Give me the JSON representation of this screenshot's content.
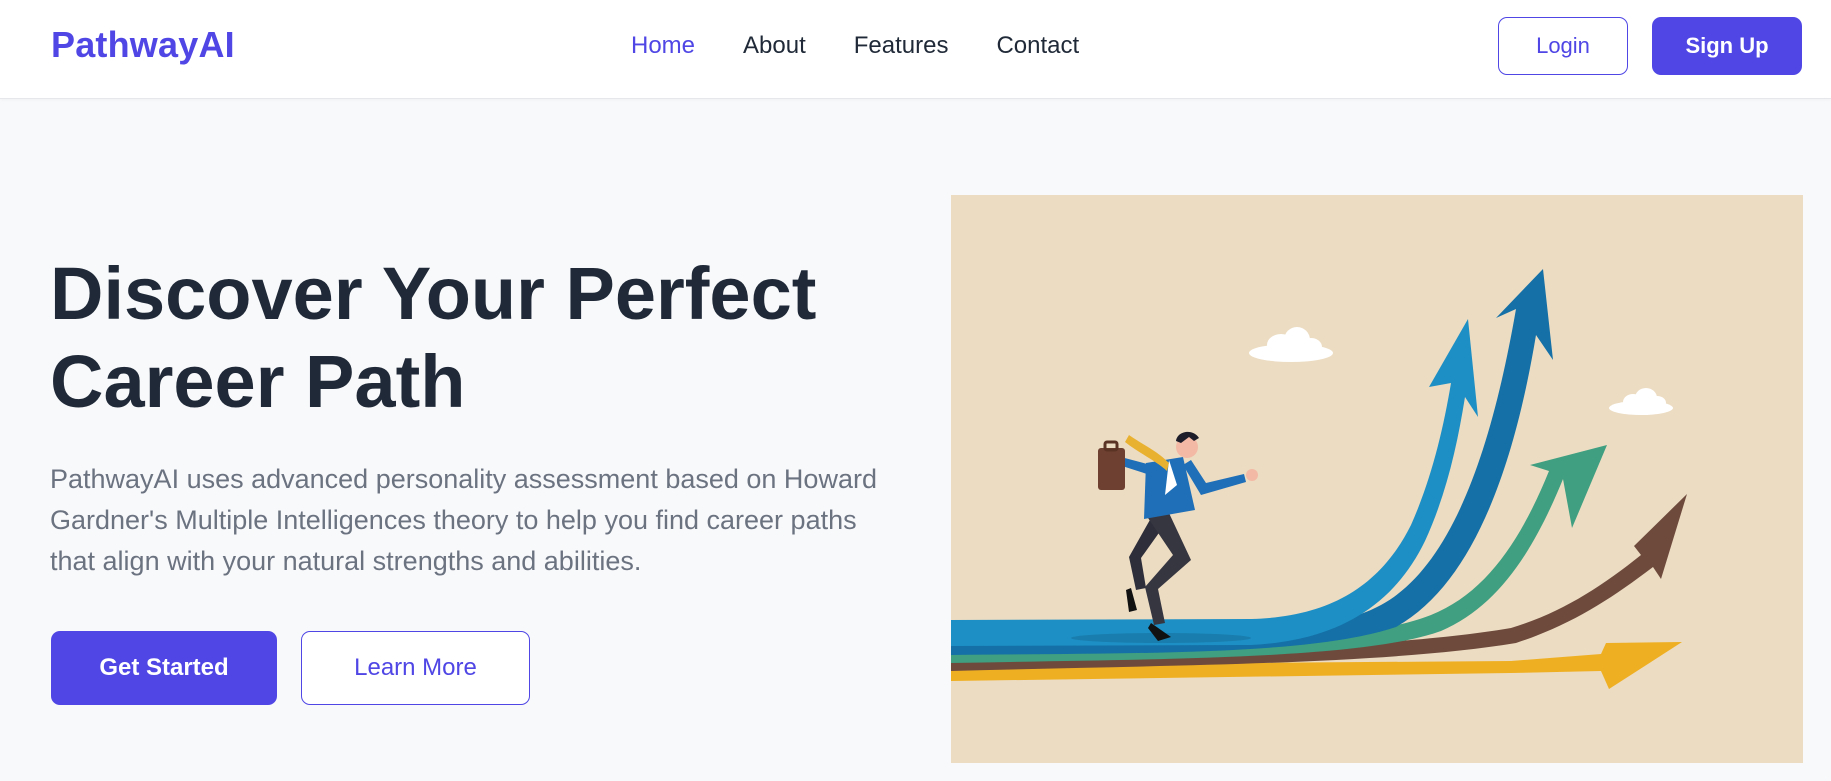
{
  "brand": {
    "name": "PathwayAI",
    "accent": "#4f46e5"
  },
  "nav": {
    "links": [
      {
        "label": "Home",
        "active": true
      },
      {
        "label": "About",
        "active": false
      },
      {
        "label": "Features",
        "active": false
      },
      {
        "label": "Contact",
        "active": false
      }
    ],
    "login_label": "Login",
    "signup_label": "Sign Up"
  },
  "hero": {
    "title_line1": "Discover Your Perfect",
    "title_line2": "Career Path",
    "description": "PathwayAI uses advanced personality assessment based on Howard Gardner's Multiple Intelligences theory to help you find career paths that align with your natural strengths and abilities.",
    "primary_cta": "Get Started",
    "secondary_cta": "Learn More"
  },
  "illustration": {
    "icon": "career-growth-illustration",
    "colors": {
      "background": "#ecdcc2",
      "arrow_light_blue": "#1d8fc4",
      "arrow_dark_blue": "#1470a6",
      "arrow_green": "#3f9f80",
      "arrow_brown": "#6e4a3d",
      "arrow_yellow": "#efaf22"
    }
  }
}
